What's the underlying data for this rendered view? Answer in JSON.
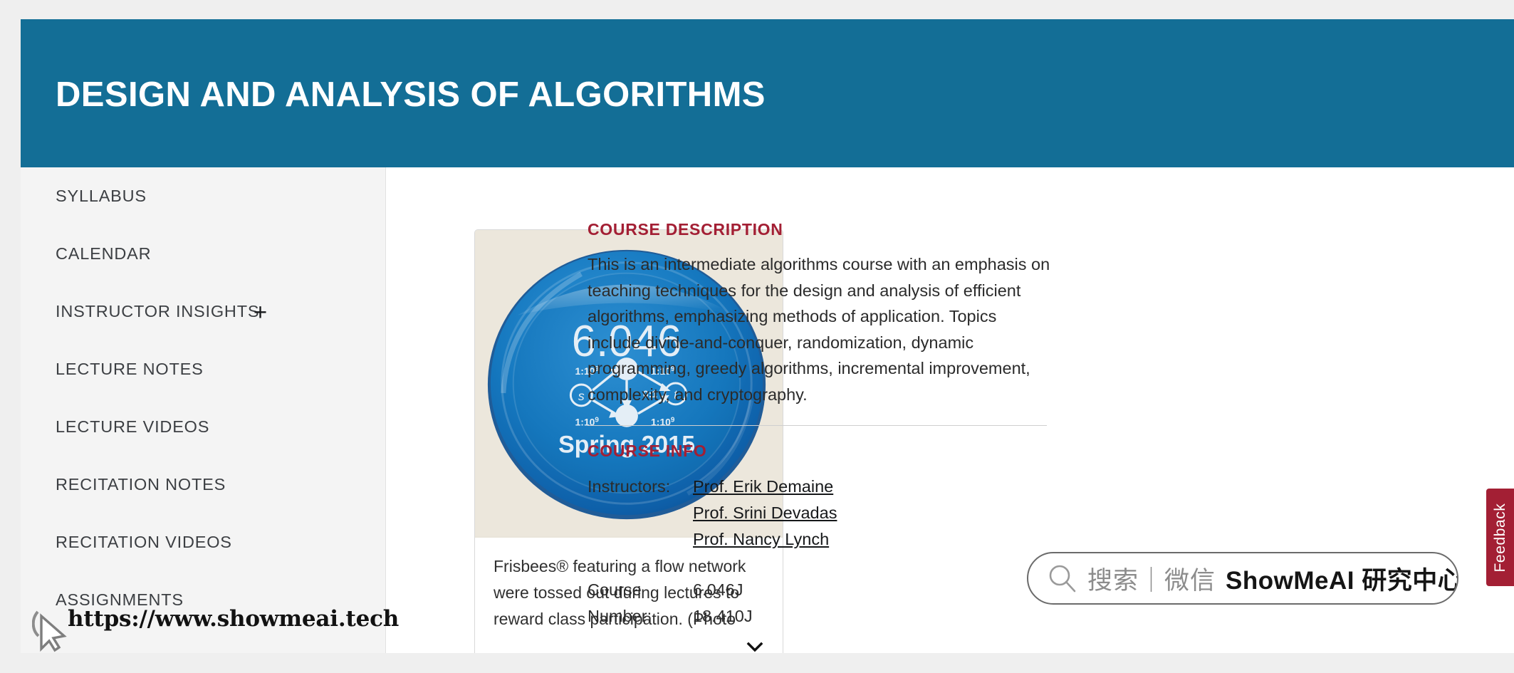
{
  "banner": {
    "title": "DESIGN AND ANALYSIS OF ALGORITHMS",
    "bg_color": "#136e96"
  },
  "sidebar": {
    "items": [
      {
        "label": "SYLLABUS",
        "expandable": false
      },
      {
        "label": "CALENDAR",
        "expandable": false
      },
      {
        "label": "INSTRUCTOR INSIGHTS",
        "expandable": true,
        "expand_icon": "plus-icon",
        "expand_glyph": "+"
      },
      {
        "label": "LECTURE NOTES",
        "expandable": false
      },
      {
        "label": "LECTURE VIDEOS",
        "expandable": false
      },
      {
        "label": "RECITATION NOTES",
        "expandable": false
      },
      {
        "label": "RECITATION VIDEOS",
        "expandable": false
      },
      {
        "label": "ASSIGNMENTS",
        "expandable": false
      }
    ]
  },
  "figure": {
    "caption": "Frisbees® featuring a flow network were tossed out during lectures to reward class participation. (Photo",
    "toggle_icon": "chevron-down-icon",
    "artwork": {
      "course_code": "6.046",
      "term": "Spring 2015",
      "source_node": "s",
      "sink_node": "t",
      "edge_labels": [
        "1:10",
        "1:10",
        "0:1",
        "1:10",
        "1:10"
      ],
      "exponent": "9",
      "disc_color": "#1072bd",
      "background_color": "#e9e5da"
    }
  },
  "course_description": {
    "heading": "COURSE DESCRIPTION",
    "body": "This is an intermediate algorithms course with an emphasis on teaching techniques for the design and analysis of efficient algorithms, emphasizing methods of application. Topics include divide-and-conquer, randomization, dynamic programming, greedy algorithms, incremental improvement, complexity, and cryptography.",
    "heading_color": "#a31f34"
  },
  "course_info": {
    "heading": "COURSE INFO",
    "instructors_label": "Instructors:",
    "instructors": [
      "Prof. Erik Demaine",
      "Prof. Srini Devadas",
      "Prof. Nancy Lynch"
    ],
    "course_number_label_line1": "Course",
    "course_number_label_line2": "Number:",
    "course_numbers": [
      "6.046J",
      "18.410J"
    ]
  },
  "feedback_tab": {
    "label": "Feedback",
    "color": "#a31f34"
  },
  "search_overlay": {
    "icon": "search-icon",
    "placeholder": "搜索｜微信",
    "brand": "ShowMeAI 研究中心"
  },
  "watermark": {
    "url": "https://www.showmeai.tech",
    "cursor_icon": "mouse-pointer-icon"
  }
}
